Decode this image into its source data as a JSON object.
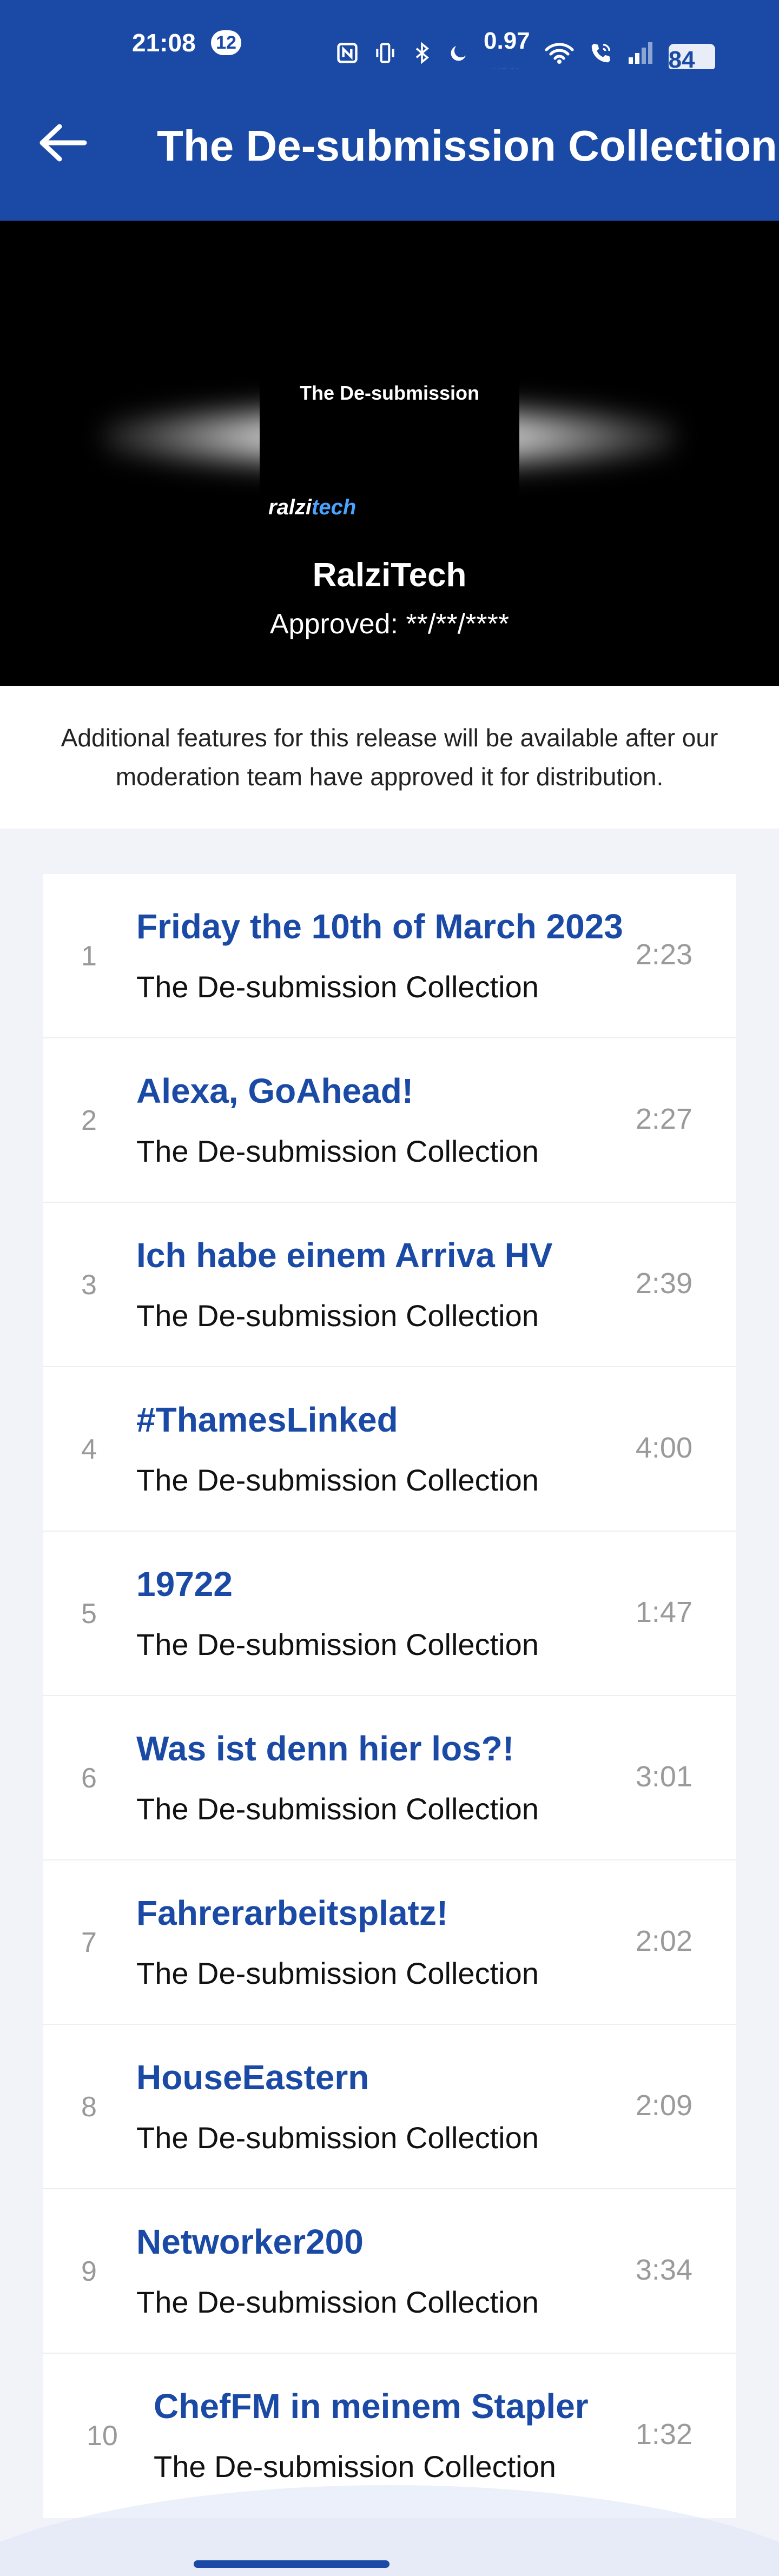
{
  "status_bar": {
    "time": "21:08",
    "notification_count": "12",
    "net_speed_value": "0.97",
    "net_speed_unit": "KB/S",
    "battery": "84"
  },
  "header": {
    "title": "The De-submission Collection"
  },
  "release": {
    "cover_title": "The De-submission",
    "cover_logo_part1": "ralzi",
    "cover_logo_part2": "tech",
    "artist": "RalziTech",
    "approved": "Approved: **/**/****"
  },
  "notice": "Additional features for this release will be available after our moderation team have approved it for distribution.",
  "tracks": [
    {
      "num": "1",
      "title": "Friday the 10th of March 2023",
      "album": "The De-submission Collection",
      "duration": "2:23"
    },
    {
      "num": "2",
      "title": "Alexa, GoAhead!",
      "album": "The De-submission Collection",
      "duration": "2:27"
    },
    {
      "num": "3",
      "title": "Ich habe einem Arriva HV",
      "album": "The De-submission Collection",
      "duration": "2:39"
    },
    {
      "num": "4",
      "title": "#ThamesLinked",
      "album": "The De-submission Collection",
      "duration": "4:00"
    },
    {
      "num": "5",
      "title": "19722",
      "album": "The De-submission Collection",
      "duration": "1:47"
    },
    {
      "num": "6",
      "title": "Was ist denn hier los?!",
      "album": "The De-submission Collection",
      "duration": "3:01"
    },
    {
      "num": "7",
      "title": "Fahrerarbeitsplatz!",
      "album": "The De-submission Collection",
      "duration": "2:02"
    },
    {
      "num": "8",
      "title": "HouseEastern",
      "album": "The De-submission Collection",
      "duration": "2:09"
    },
    {
      "num": "9",
      "title": "Networker200",
      "album": "The De-submission Collection",
      "duration": "3:34"
    },
    {
      "num": "10",
      "title": "ChefFM in meinem Stapler",
      "album": "The De-submission Collection",
      "duration": "1:32"
    }
  ],
  "colors": {
    "brand": "#1a4aa5",
    "title_text": "#1a4aa5",
    "page_bg": "#f1f3f9"
  },
  "icons": {
    "back": "arrow-left-icon",
    "nfc": "nfc-icon",
    "vibrate": "vibrate-icon",
    "bluetooth": "bluetooth-icon",
    "dnd": "moon-icon",
    "wifi": "wifi-icon",
    "call": "wifi-call-icon",
    "signal": "signal-icon"
  }
}
